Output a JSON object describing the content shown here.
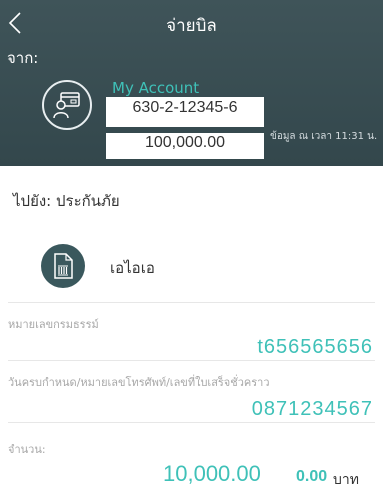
{
  "header": {
    "title": "จ่ายบิล",
    "from_label": "จาก:",
    "account": {
      "name": "My Account",
      "number": "630-2-12345-6",
      "balance": "100,000.00",
      "timestamp": "ข้อมูล ณ เวลา 11:31 น."
    }
  },
  "payee": {
    "to_label": "ไปยัง: ประกันภัย",
    "biller_name": "เอไอเอ"
  },
  "fields": {
    "ref1_label": "หมายเลขกรมธรรม์",
    "ref1_value": "t656565656",
    "ref2_label": "วันครบกำหนด/หมายเลขโทรศัพท์/เลขที่ใบเสร็จชั่วคราว",
    "ref2_value": "0871234567",
    "amount_label": "จำนวน:",
    "amount_value": "10,000.00",
    "fee_value": "0.00",
    "currency": "บาท"
  },
  "colors": {
    "header_bg": "#3f5459",
    "accent": "#3fc1b8",
    "biller_icon_bg": "#3a585d"
  }
}
